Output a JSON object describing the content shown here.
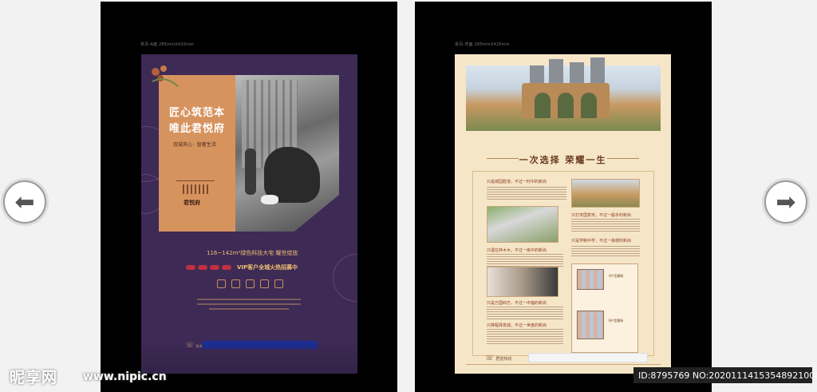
{
  "left_poster": {
    "spec_text": "单页-A面  285mmX420mm",
    "headline_line1": "匠心筑范本",
    "headline_line2": "唯此君悦府",
    "subtitle": "双城央心 · 智奢生活",
    "logo_name": "君悦府",
    "feature_text": "116~142m²绿色科技大宅  耀世绽放",
    "vip_text": "VIP客户全城火热招募中",
    "hotline_label": "垂询热线"
  },
  "right_poster": {
    "spec_text": "单页-背面  285mmX420mm",
    "heading": "一次选择 荣耀一生",
    "sections": [
      "只是城园胜境，不过一时中的新尚",
      "只打宋国意宋，不过一般手的新尚",
      "只遇在林木木，不过一练中的新尚",
      "只是学制中学，不过一栋楼的新尚",
      "只是万国四方，不过一中轴的新尚",
      "只撑程择意城，不过一世度的新尚"
    ],
    "floorplan_a_label": "A户型解析",
    "floorplan_b_label": "B户型解析",
    "hotline_label": "君悦热线"
  },
  "navigation": {
    "prev_icon": "arrow-left-icon",
    "next_icon": "arrow-right-icon",
    "prev_glyph": "⬅",
    "next_glyph": "➡"
  },
  "watermark": {
    "brand": "昵享网",
    "url": "www.nipic.cn",
    "id_text": "ID:8795769 NO:20201114153548921000"
  }
}
